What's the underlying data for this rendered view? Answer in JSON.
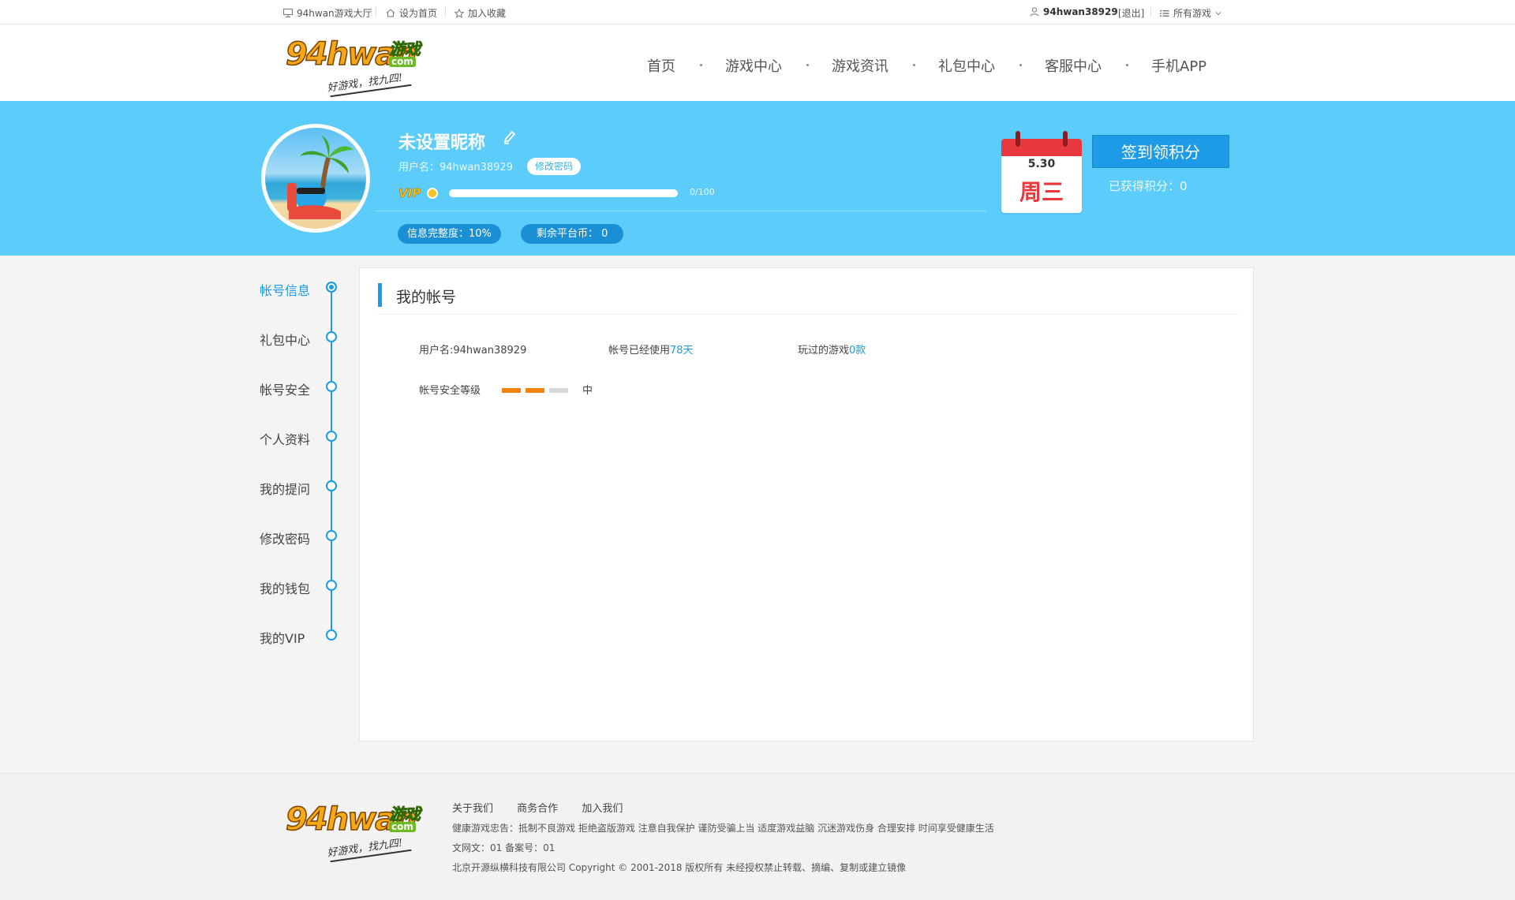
{
  "topbar": {
    "lobby": "94hwan游戏大厅",
    "set_home": "设为首页",
    "bookmark": "加入收藏",
    "username": "94hwan38929",
    "logout": "[退出]",
    "all_games": "所有游戏"
  },
  "logo": {
    "main": "94hwan",
    "cn": "游戏",
    "com": "com",
    "slogan": "好游戏，找九四!"
  },
  "nav": [
    "首页",
    "游戏中心",
    "游戏资讯",
    "礼包中心",
    "客服中心",
    "手机APP"
  ],
  "profile": {
    "nickname": "未设置昵称",
    "username_line": "用户名：94hwan38929",
    "change_password": "修改密码",
    "vip": "VIP",
    "vip_progress": 0,
    "vip_progress_text": "0/100",
    "completeness": "信息完整度：10%",
    "coins": "剩余平台币： 0"
  },
  "calendar": {
    "date": "5.30",
    "weekday": "周三"
  },
  "signin": {
    "button": "签到领积分",
    "points": "已获得积分：0"
  },
  "sidebar": {
    "items": [
      "帐号信息",
      "礼包中心",
      "帐号安全",
      "个人资料",
      "我的提问",
      "修改密码",
      "我的钱包",
      "我的VIP"
    ],
    "active_index": 0
  },
  "account": {
    "title": "我的帐号",
    "username": "用户名:94hwan38929",
    "used_prefix": "帐号已经使用",
    "used_value": "78天",
    "played_prefix": "玩过的游戏",
    "played_value": "0款",
    "security_label": "帐号安全等级",
    "security_bars": [
      "#f5820d",
      "#f5820d",
      "#d9d9d9"
    ],
    "security_level": "中"
  },
  "footer": {
    "links": [
      "关于我们",
      "商务合作",
      "加入我们"
    ],
    "health": "健康游戏忠告：抵制不良游戏 拒绝盗版游戏 注意自我保护 谨防受骗上当 适度游戏益脑 沉迷游戏伤身 合理安排 时间享受健康生活",
    "license": "文网文：01 备案号：01",
    "copyright": "北京开源纵横科技有限公司 Copyright © 2001-2018 版权所有 未经授权禁止转载、摘编、复制或建立镜像"
  },
  "colors": {
    "accent": "#1e9be6",
    "banner": "#5ccdfb",
    "calendar_red": "#e8383d",
    "security_orange": "#f5820d"
  }
}
